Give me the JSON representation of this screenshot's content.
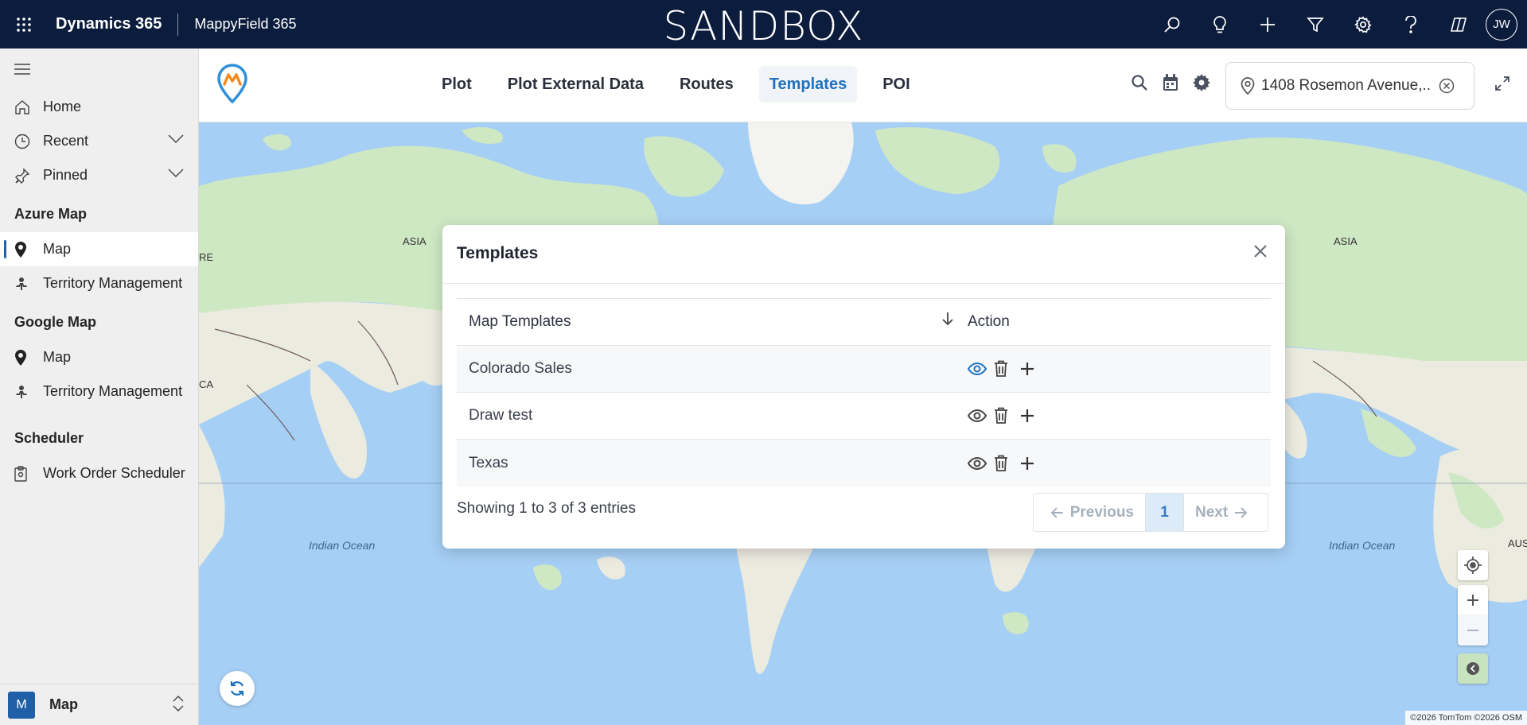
{
  "topbar": {
    "product": "Dynamics 365",
    "app": "MappyField 365",
    "environment": "SANDBOX",
    "user_initials": "JW",
    "icons": [
      "app-launcher-icon",
      "search-icon",
      "lightbulb-icon",
      "plus-icon",
      "filter-icon",
      "gear-icon",
      "help-icon",
      "copilot-icon"
    ],
    "bg_color": "#0b1c3d"
  },
  "leftnav": {
    "items": [
      {
        "label": "Home",
        "icon": "home-icon"
      },
      {
        "label": "Recent",
        "icon": "clock-icon",
        "expandable": true
      },
      {
        "label": "Pinned",
        "icon": "pin-icon",
        "expandable": true
      }
    ],
    "groups": [
      {
        "title": "Azure Map",
        "items": [
          {
            "label": "Map",
            "icon": "map-pin-icon",
            "selected": true
          },
          {
            "label": "Territory Management",
            "icon": "territory-icon"
          }
        ]
      },
      {
        "title": "Google Map",
        "items": [
          {
            "label": "Map",
            "icon": "map-pin-icon"
          },
          {
            "label": "Territory Management",
            "icon": "territory-icon"
          }
        ]
      },
      {
        "title": "Scheduler",
        "items": [
          {
            "label": "Work Order Scheduler",
            "icon": "clipboard-icon"
          }
        ]
      }
    ],
    "area": {
      "badge": "M",
      "name": "Map"
    }
  },
  "header": {
    "tabs": [
      {
        "label": "Plot",
        "active": false
      },
      {
        "label": "Plot External Data",
        "active": false
      },
      {
        "label": "Routes",
        "active": false
      },
      {
        "label": "Templates",
        "active": true
      },
      {
        "label": "POI",
        "active": false
      }
    ],
    "location_value": "1408 Rosemon Avenue,...",
    "accent_color": "#1f72c0"
  },
  "map": {
    "labels": {
      "asia_left": "ASIA",
      "asia_right": "ASIA",
      "ocean_left": "Indian Ocean",
      "ocean_right": "Indian Ocean",
      "ca": "CA",
      "re": "RE",
      "aus": "AUS"
    },
    "attribution": "©2026 TomTom ©2026 OSM"
  },
  "modal": {
    "title": "Templates",
    "columns": [
      "Map Templates",
      "Action"
    ],
    "rows": [
      {
        "name": "Colorado Sales"
      },
      {
        "name": "Draw test"
      },
      {
        "name": "Texas"
      }
    ],
    "info": "Showing 1 to 3 of 3 entries",
    "pagination": {
      "previous": "Previous",
      "page": "1",
      "next": "Next"
    }
  }
}
